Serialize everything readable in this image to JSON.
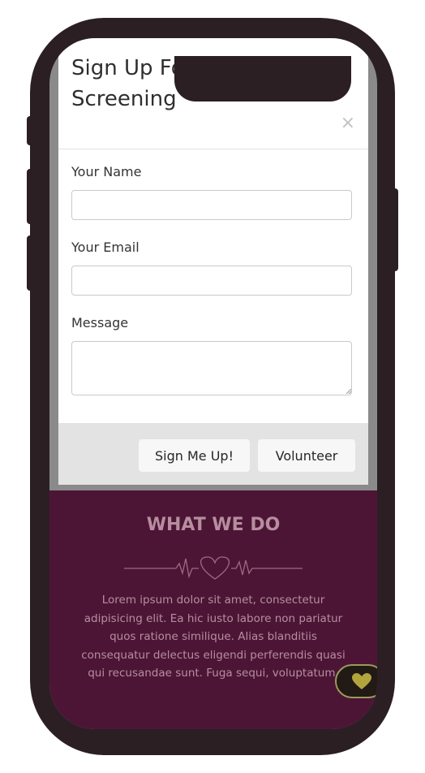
{
  "modal": {
    "title": "Sign Up For Ongoing Screening",
    "close_label": "×",
    "fields": {
      "name_label": "Your Name",
      "name_value": "",
      "email_label": "Your Email",
      "email_value": "",
      "message_label": "Message",
      "message_value": ""
    },
    "buttons": {
      "signup_label": "Sign Me Up!",
      "volunteer_label": "Volunteer"
    }
  },
  "section": {
    "title": "WHAT WE DO",
    "body": "Lorem ipsum dolor sit amet, consectetur adipisicing elit. Ea hic iusto labore non pariatur quos ratione similique. Alias blanditiis consequatur delectus eligendi perferendis quasi qui recusandae sunt. Fuga sequi, voluptatum.",
    "divider_icon": "heartbeat-heart-icon"
  },
  "fab": {
    "icon": "heart-icon"
  },
  "colors": {
    "phone_frame": "#2b1f24",
    "section_bg": "#4d1535",
    "section_text": "#b58ea0",
    "fab_heart": "#b3a53d"
  }
}
